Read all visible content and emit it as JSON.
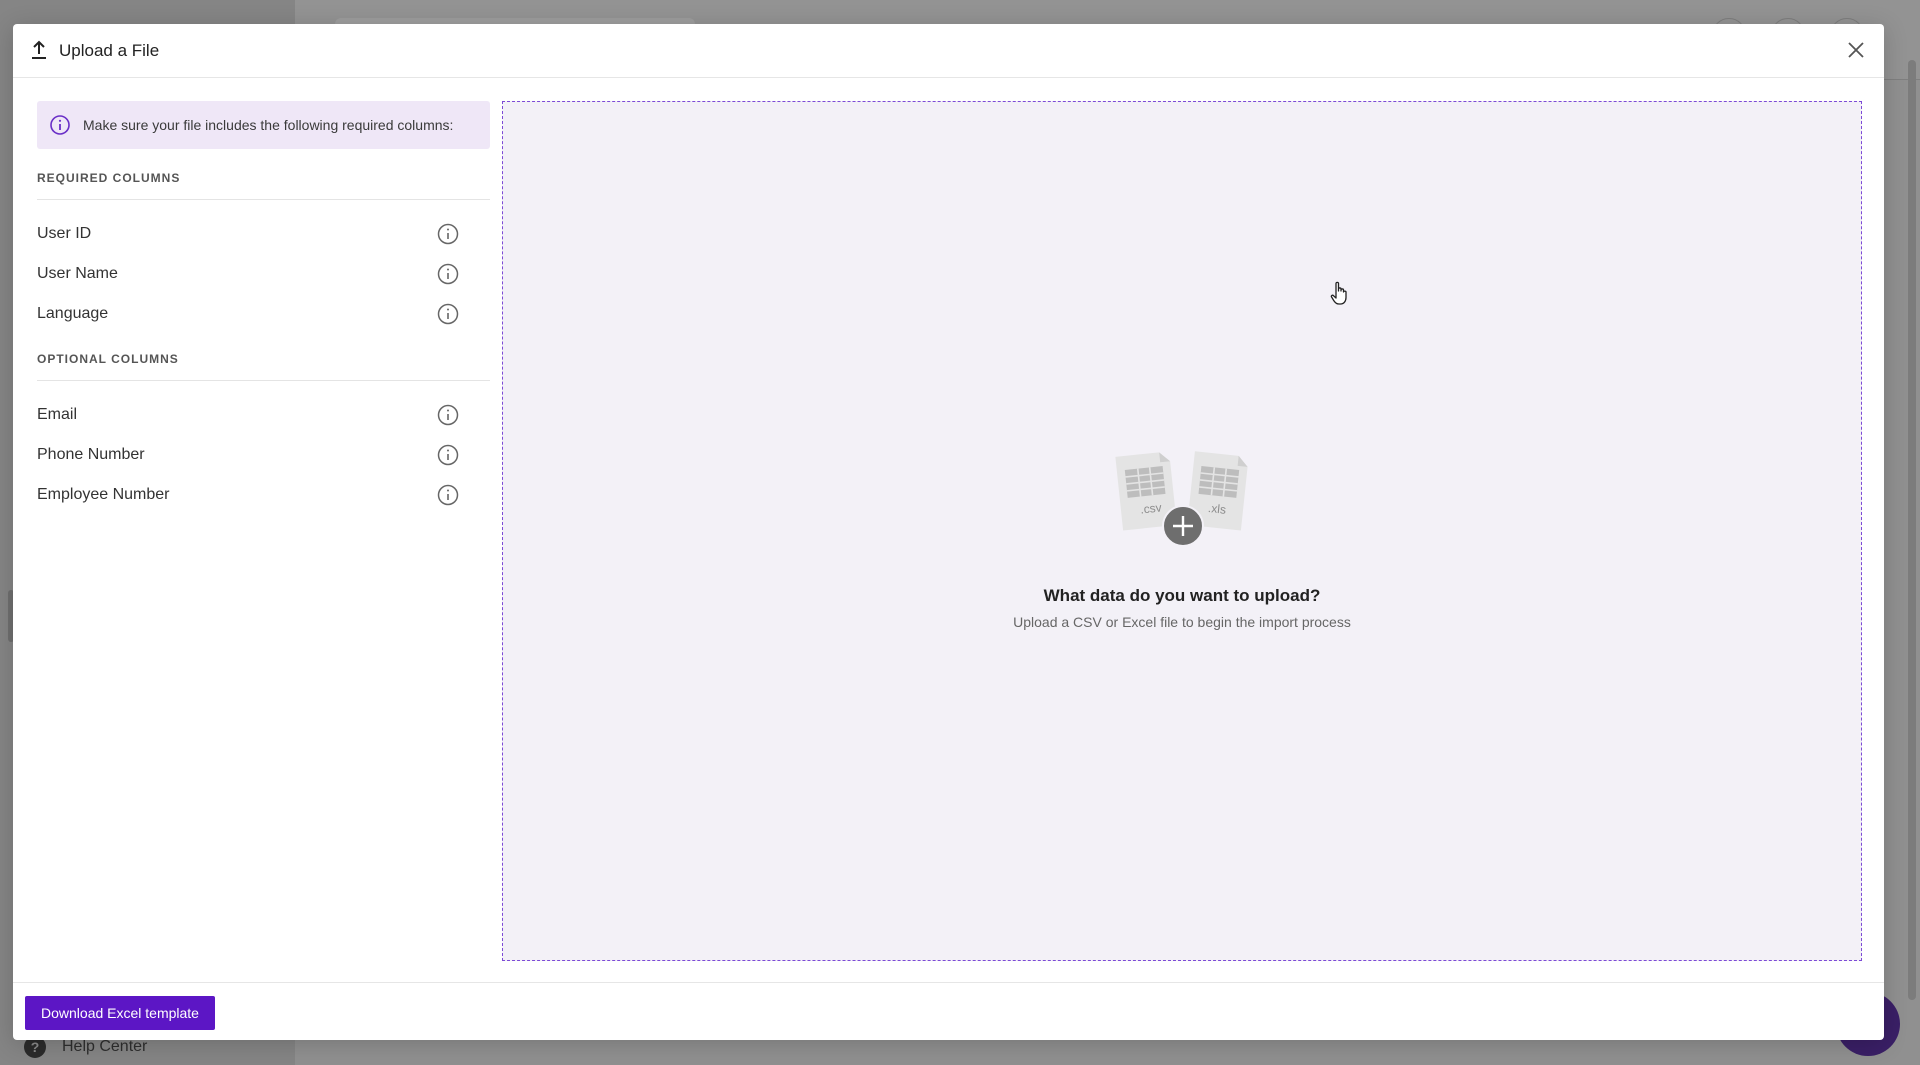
{
  "background": {
    "help_center_label": "Help Center"
  },
  "modal": {
    "title": "Upload a File",
    "icon": "upload-icon",
    "close_icon": "close-icon"
  },
  "info_banner": {
    "text": "Make sure your file includes the following required columns:",
    "icon": "info-icon"
  },
  "required_columns": {
    "title": "REQUIRED COLUMNS",
    "items": [
      {
        "label": "User ID"
      },
      {
        "label": "User Name"
      },
      {
        "label": "Language"
      }
    ]
  },
  "optional_columns": {
    "title": "OPTIONAL COLUMNS",
    "items": [
      {
        "label": "Email"
      },
      {
        "label": "Phone Number"
      },
      {
        "label": "Employee Number"
      }
    ]
  },
  "dropzone": {
    "title": "What data do you want to upload?",
    "subtitle": "Upload a CSV or Excel file to begin the import process",
    "file_labels": [
      ".csv",
      ".xls"
    ]
  },
  "footer": {
    "download_label": "Download Excel template"
  },
  "colors": {
    "accent": "#5c16c5",
    "banner_bg": "#efe7f7",
    "dropzone_bg": "#f3f1f7",
    "dropzone_border": "#7c4ad6"
  }
}
